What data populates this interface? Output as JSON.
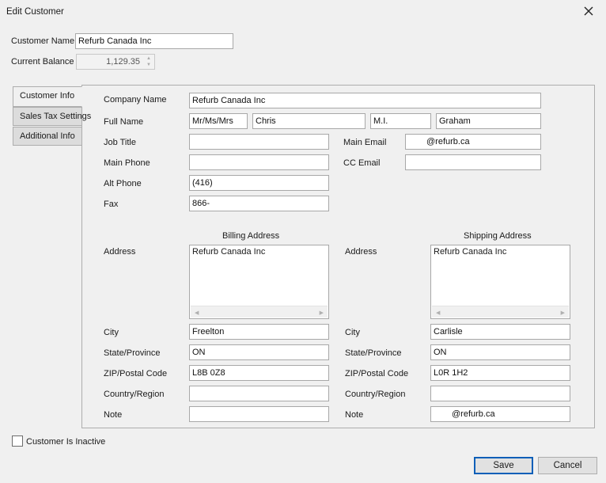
{
  "window": {
    "title": "Edit Customer"
  },
  "customer_name": {
    "label": "Customer Name",
    "value": "Refurb Canada Inc"
  },
  "current_balance": {
    "label": "Current Balance",
    "value": "1,129.35"
  },
  "tabs": [
    "Customer Info",
    "Sales Tax Settings",
    "Additional Info"
  ],
  "info": {
    "company_name": {
      "label": "Company Name",
      "value": "Refurb Canada Inc"
    },
    "full_name": {
      "label": "Full Name",
      "salutation": "Mr/Ms/Mrs",
      "first": "Chris",
      "middle": "M.I.",
      "last": "Graham"
    },
    "job_title": {
      "label": "Job Title",
      "value": ""
    },
    "main_phone": {
      "label": "Main Phone",
      "value": ""
    },
    "alt_phone": {
      "label": "Alt Phone",
      "value": "(416)"
    },
    "fax": {
      "label": "Fax",
      "value": "866-"
    },
    "main_email": {
      "label": "Main Email",
      "value": "@refurb.ca"
    },
    "cc_email": {
      "label": "CC Email",
      "value": ""
    }
  },
  "billing": {
    "heading": "Billing Address",
    "address_label": "Address",
    "address": "Refurb Canada Inc",
    "city_label": "City",
    "city": "Freelton",
    "state_label": "State/Province",
    "state": "ON",
    "zip_label": "ZIP/Postal Code",
    "zip": "L8B 0Z8",
    "country_label": "Country/Region",
    "country": "",
    "note_label": "Note",
    "note": ""
  },
  "shipping": {
    "heading": "Shipping Address",
    "address_label": "Address",
    "address": "Refurb Canada Inc",
    "city_label": "City",
    "city": "Carlisle",
    "state_label": "State/Province",
    "state": "ON",
    "zip_label": "ZIP/Postal Code",
    "zip": "L0R 1H2",
    "country_label": "Country/Region",
    "country": "",
    "note_label": "Note",
    "note": "@refurb.ca"
  },
  "inactive": {
    "label": "Customer Is Inactive",
    "checked": false
  },
  "buttons": {
    "save": "Save",
    "cancel": "Cancel"
  },
  "icons": {
    "close": "close-icon",
    "spin_up": "chevron-up-icon",
    "spin_down": "chevron-down-icon",
    "scroll_left": "arrow-left-icon",
    "scroll_right": "arrow-right-icon"
  }
}
